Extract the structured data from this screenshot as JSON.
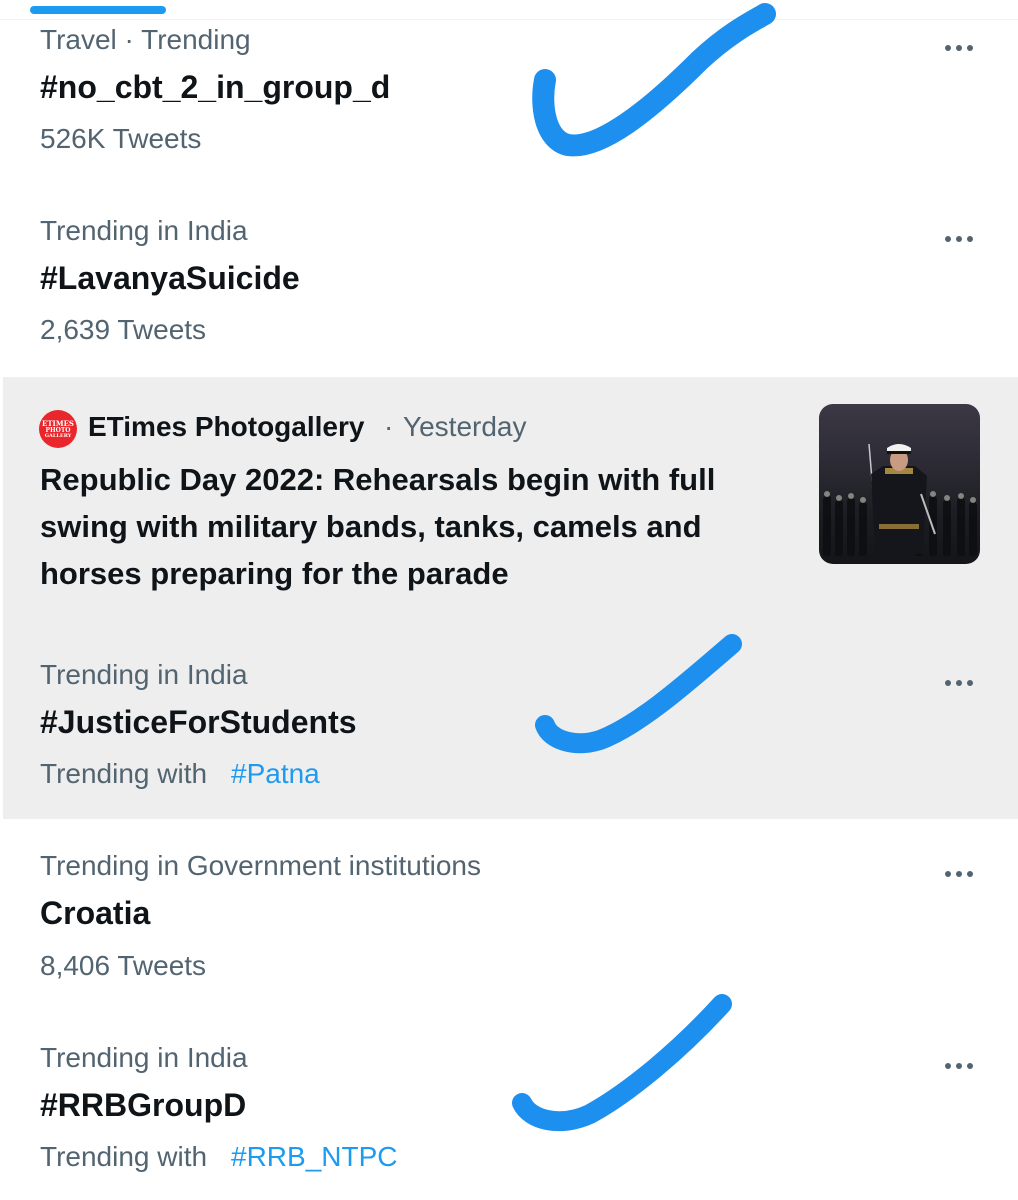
{
  "colors": {
    "accent": "#1d9bf0",
    "marker": "#1d8fef",
    "highlight_bg": "#eeeeee",
    "secondary_text": "#536471",
    "primary_text": "#0f1419",
    "news_logo_bg": "#e8262b"
  },
  "trends": [
    {
      "context": "Travel · Trending",
      "title": "#no_cbt_2_in_group_d",
      "count": "526K Tweets",
      "menu_icon": "more-horizontal-icon"
    },
    {
      "context": "Trending in India",
      "title": "#LavanyaSuicide",
      "count": "2,639 Tweets",
      "menu_icon": "more-horizontal-icon"
    },
    {
      "context": "Trending in India",
      "title": "#JusticeForStudents",
      "trending_with_label": "Trending with",
      "trending_with_tag": "#Patna",
      "menu_icon": "more-horizontal-icon"
    },
    {
      "context": "Trending in Government institutions",
      "title": "Croatia",
      "count": "8,406 Tweets",
      "menu_icon": "more-horizontal-icon"
    },
    {
      "context": "Trending in India",
      "title": "#RRBGroupD",
      "trending_with_label": "Trending with",
      "trending_with_tag": "#RRB_NTPC",
      "menu_icon": "more-horizontal-icon"
    }
  ],
  "news": {
    "source": "ETimes Photogallery",
    "separator": "·",
    "time": "Yesterday",
    "logo_lines": [
      "ETIMES",
      "PHOTO",
      "GALLERY"
    ],
    "headline": "Republic Day 2022: Rehearsals begin with full swing with military bands, tanks, camels and horses preparing for the parade",
    "thumbnail_icon": "news-photo-thumbnail"
  },
  "annotations": {
    "marker_icon": "hand-drawn-checkmark-icon",
    "count": 3
  }
}
